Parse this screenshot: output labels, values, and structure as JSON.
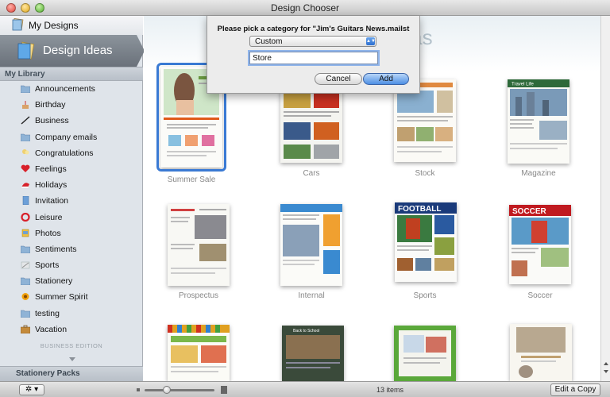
{
  "window": {
    "title": "Design Chooser"
  },
  "sidebar": {
    "my_designs": "My Designs",
    "design_ideas": "Design Ideas",
    "library_header": "My Library",
    "items": [
      {
        "label": "Announcements",
        "icon": "folder-icon"
      },
      {
        "label": "Birthday",
        "icon": "cake-icon"
      },
      {
        "label": "Business",
        "icon": "pen-icon"
      },
      {
        "label": "Company emails",
        "icon": "folder-icon"
      },
      {
        "label": "Congratulations",
        "icon": "balloon-icon"
      },
      {
        "label": "Feelings",
        "icon": "heart-icon"
      },
      {
        "label": "Holidays",
        "icon": "santa-hat-icon"
      },
      {
        "label": "Invitation",
        "icon": "card-icon"
      },
      {
        "label": "Leisure",
        "icon": "lifebuoy-icon"
      },
      {
        "label": "Photos",
        "icon": "photos-icon"
      },
      {
        "label": "Sentiments",
        "icon": "folder-icon"
      },
      {
        "label": "Sports",
        "icon": "sports-icon"
      },
      {
        "label": "Stationery",
        "icon": "folder-icon"
      },
      {
        "label": "Summer Spirit",
        "icon": "sun-icon"
      },
      {
        "label": "testing",
        "icon": "folder-icon"
      },
      {
        "label": "Vacation",
        "icon": "suitcase-icon"
      }
    ],
    "edition": "BUSINESS EDITION",
    "stationery_packs": "Stationery Packs"
  },
  "main": {
    "background_title": "Ideas",
    "background_subtitle": "ails",
    "templates": [
      {
        "name": "Summer Sale",
        "selected": true,
        "header_text": ""
      },
      {
        "name": "Cars",
        "selected": false,
        "header_text": ""
      },
      {
        "name": "Stock",
        "selected": false,
        "header_text": ""
      },
      {
        "name": "Magazine",
        "selected": false,
        "header_text": "Travel Life"
      },
      {
        "name": "Prospectus",
        "selected": false,
        "header_text": ""
      },
      {
        "name": "Internal",
        "selected": false,
        "header_text": ""
      },
      {
        "name": "Sports",
        "selected": false,
        "header_text": "FOOTBALL"
      },
      {
        "name": "Soccer",
        "selected": false,
        "header_text": "SOCCER"
      },
      {
        "name": "",
        "selected": false,
        "header_text": ""
      },
      {
        "name": "",
        "selected": false,
        "header_text": "Back to School"
      },
      {
        "name": "",
        "selected": false,
        "header_text": ""
      },
      {
        "name": "",
        "selected": false,
        "header_text": ""
      }
    ]
  },
  "dialog": {
    "prompt": "Please pick a category for \"Jim's Guitars News.mailst",
    "category_value": "Custom",
    "name_value": "Store",
    "cancel_label": "Cancel",
    "add_label": "Add"
  },
  "bottombar": {
    "gear_label": "✲ ▾",
    "items_count": "13 items",
    "edit_copy_label": "Edit a Copy",
    "zoom_fraction": 0.3
  },
  "colors": {
    "selection": "#3a7ad4",
    "sidebar_selected": "#6a717a",
    "default_button": "#4d8fe4"
  }
}
